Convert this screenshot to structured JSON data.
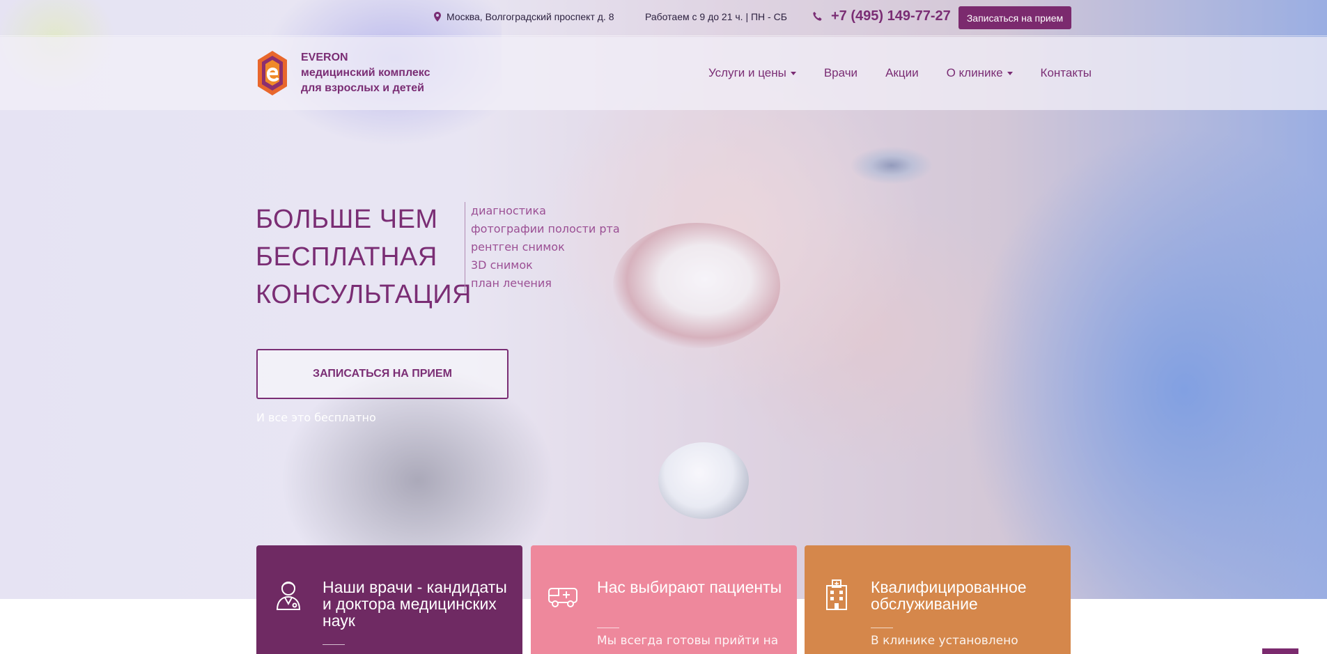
{
  "topbar": {
    "address": "Москва, Волгоградский проспект д. 8",
    "hours": "Работаем с 9 до 21 ч. | ПН - СБ",
    "phone": "+7 (495) 149-77-27",
    "cta_label": "Записаться на прием"
  },
  "logo": {
    "name": "EVERON",
    "line2": "медицинский комплекс",
    "line3": "для взрослых и детей"
  },
  "nav": {
    "services": "Услуги и цены",
    "doctors": "Врачи",
    "promos": "Акции",
    "about": "О клинике",
    "contacts": "Контакты"
  },
  "hero": {
    "headline": [
      "БОЛЬШЕ ЧЕМ",
      "БЕСПЛАТНАЯ",
      "КОНСУЛЬТАЦИЯ"
    ],
    "features": [
      "диагностика",
      "фотографии полости рта",
      "рентген снимок",
      "3D снимок",
      "план лечения"
    ],
    "button_label": "ЗАПИСАТЬСЯ НА ПРИЕМ",
    "note": "И все это бесплатно"
  },
  "cards": [
    {
      "title": "Наши врачи - кандидаты и доктора медицинских наук",
      "icon": "doctor-icon",
      "color": "#6f2a63",
      "desc": ""
    },
    {
      "title": "Нас выбирают пациенты",
      "icon": "ambulance-icon",
      "color": "#ee889c",
      "desc": "Мы всегда готовы прийти на"
    },
    {
      "title": "Квалифицированное обслуживание",
      "icon": "hospital-icon",
      "color": "#d5874b",
      "desc": "В клинике установлено"
    }
  ],
  "colors": {
    "brand": "#7a2d74",
    "cta_bg": "#7b2a6e"
  }
}
